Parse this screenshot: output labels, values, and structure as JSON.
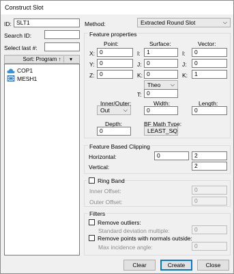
{
  "window": {
    "title": "Construct Slot"
  },
  "left": {
    "id_label": "ID:",
    "id_value": "SLT1",
    "search_label": "Search ID:",
    "search_value": "",
    "select_last_label": "Select last #:",
    "select_last_value": "",
    "sort_label": "Sort: Program ↑",
    "sort_arrow": "▾",
    "items": [
      {
        "label": "COP1",
        "icon": "cloud-icon"
      },
      {
        "label": "MESH1",
        "icon": "mesh-icon"
      }
    ]
  },
  "method": {
    "label": "Method:",
    "value": "Extracted Round Slot"
  },
  "feature_props": {
    "title": "Feature properties",
    "point_header": "Point:",
    "surface_header": "Surface:",
    "vector_header": "Vector:",
    "point": [
      {
        "axis": "X:",
        "value": "0"
      },
      {
        "axis": "Y:",
        "value": "0"
      },
      {
        "axis": "Z:",
        "value": "0"
      }
    ],
    "surface": [
      {
        "axis": "I:",
        "value": "1"
      },
      {
        "axis": "J:",
        "value": "0"
      },
      {
        "axis": "K:",
        "value": "0"
      }
    ],
    "vector": [
      {
        "axis": "I:",
        "value": "0"
      },
      {
        "axis": "J:",
        "value": "0"
      },
      {
        "axis": "K:",
        "value": "1"
      }
    ],
    "theo_value": "Theo",
    "t_label": "T:",
    "t_value": "0",
    "inner_outer_label": "Inner/Outer:",
    "inner_outer_value": "Out",
    "width_label": "Width:",
    "width_value": "0",
    "length_label": "Length:",
    "length_value": "0",
    "depth_label": "Depth:",
    "depth_value": "0",
    "bf_label": "BF Math Type:",
    "bf_value": "LEAST_SQI"
  },
  "clipping": {
    "title": "Feature Based Clipping",
    "horizontal_label": "Horizontal:",
    "horizontal_1": "0",
    "horizontal_2": "2",
    "vertical_label": "Vertical:",
    "vertical_value": "2"
  },
  "ring_band": {
    "label": "Ring Band",
    "inner_label": "Inner Offset:",
    "inner_value": "0",
    "outer_label": "Outer Offset:",
    "outer_value": "0"
  },
  "filters": {
    "title": "Filters",
    "remove_outliers_label": "Remove outliers:",
    "std_dev_label": "Standard deviation multiple:",
    "std_dev_value": "0",
    "remove_normals_label": "Remove points with normals outside:",
    "max_angle_label": "Max incidence angle:",
    "max_angle_value": "0"
  },
  "buttons": {
    "clear": "Clear",
    "create": "Create",
    "close": "Close"
  },
  "colors": {
    "accent": "#0078d7",
    "cloud_icon": "#3d8fd6",
    "mesh_icon": "#2c6fb5"
  }
}
